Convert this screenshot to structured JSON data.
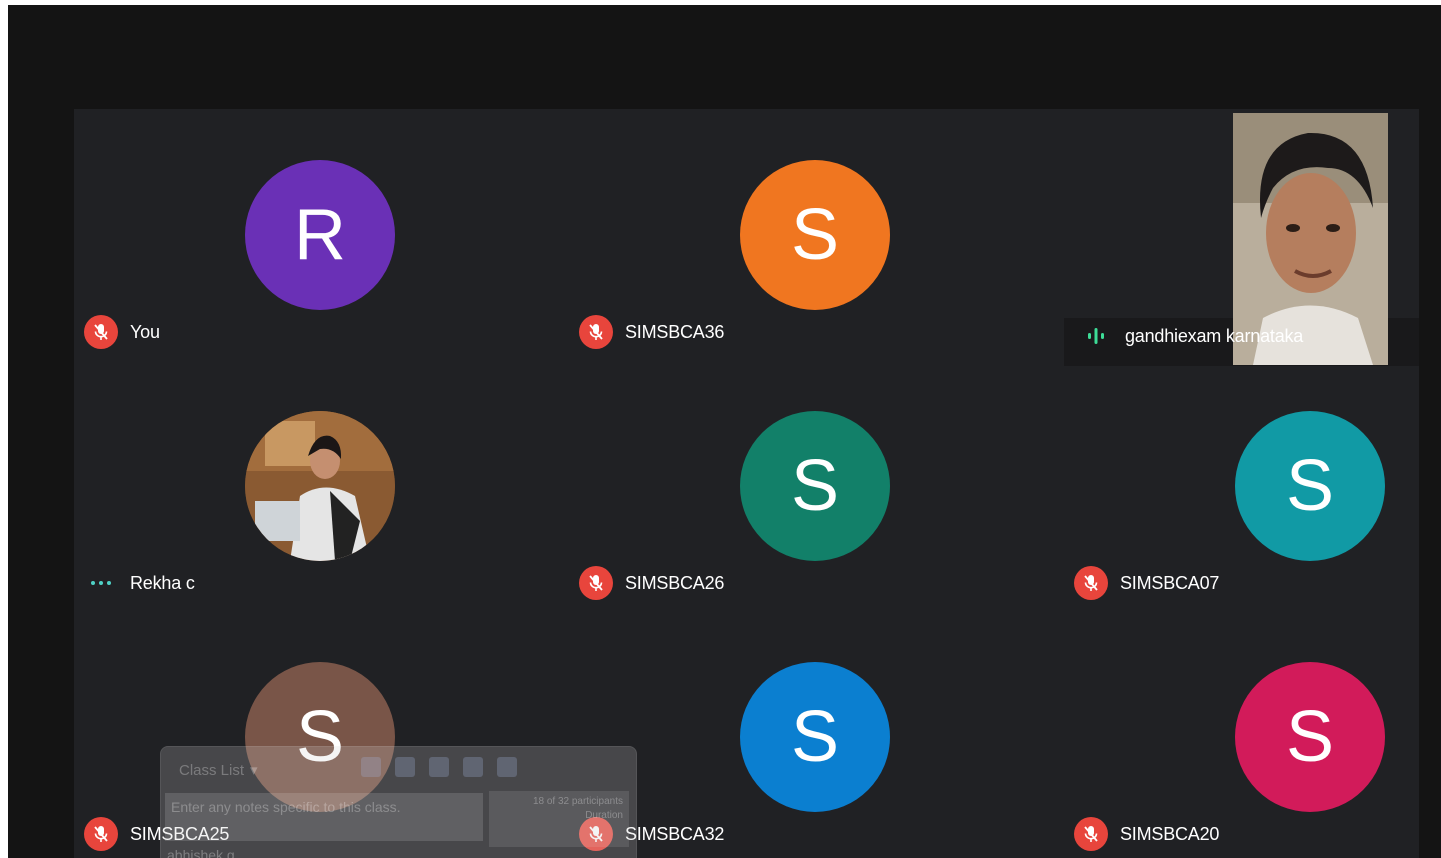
{
  "participants": [
    {
      "name": "You",
      "initial": "R",
      "color": "#6a30b6",
      "status": "muted"
    },
    {
      "name": "SIMSBCA36",
      "initial": "S",
      "color": "#f07620",
      "status": "muted"
    },
    {
      "name": "gandhiexam karnataka",
      "initial": "",
      "color": "",
      "status": "speaking"
    },
    {
      "name": "Rekha c",
      "initial": "",
      "color": "#6b4a2b",
      "status": "connecting"
    },
    {
      "name": "SIMSBCA26",
      "initial": "S",
      "color": "#128069",
      "status": "muted"
    },
    {
      "name": "SIMSBCA07",
      "initial": "S",
      "color": "#119aa5",
      "status": "muted"
    },
    {
      "name": "SIMSBCA25",
      "initial": "S",
      "color": "#795548",
      "status": "muted"
    },
    {
      "name": "SIMSBCA32",
      "initial": "S",
      "color": "#0b7fd0",
      "status": "muted"
    },
    {
      "name": "SIMSBCA20",
      "initial": "S",
      "color": "#d21b5a",
      "status": "muted"
    }
  ],
  "overlay": {
    "title": "Class List",
    "notes_placeholder": "Enter any notes specific to this class.",
    "participants_info": "18 of 32 participants",
    "duration_label": "Duration",
    "bottom_text": "abhishek g"
  }
}
